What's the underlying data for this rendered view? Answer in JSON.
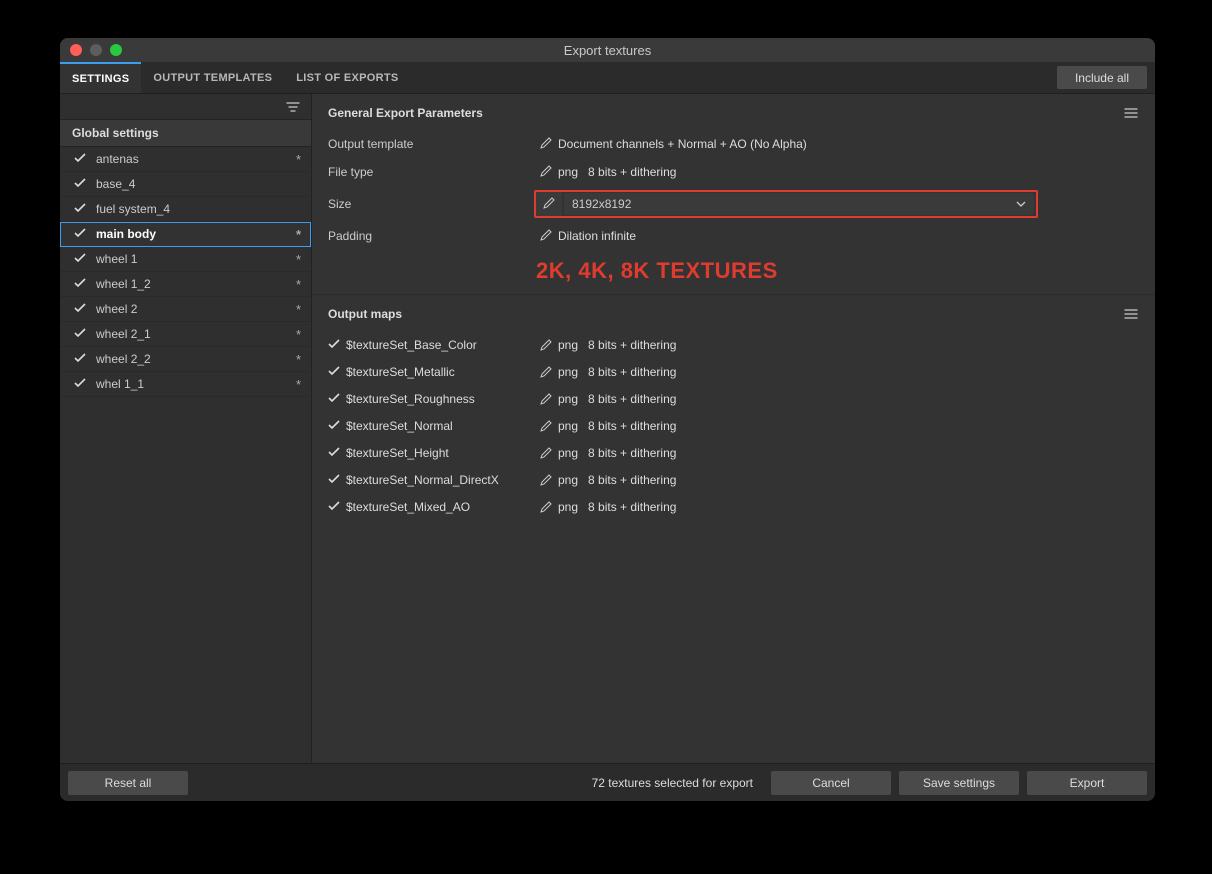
{
  "window": {
    "title": "Export textures"
  },
  "toolbar": {
    "tabs": [
      {
        "label": "SETTINGS",
        "active": true
      },
      {
        "label": "OUTPUT TEMPLATES",
        "active": false
      },
      {
        "label": "LIST OF EXPORTS",
        "active": false
      }
    ],
    "include_all": "Include all"
  },
  "sidebar": {
    "global_settings": "Global settings",
    "items": [
      {
        "name": "antenas",
        "modified": true,
        "selected": false
      },
      {
        "name": "base_4",
        "modified": false,
        "selected": false
      },
      {
        "name": "fuel system_4",
        "modified": false,
        "selected": false
      },
      {
        "name": "main body",
        "modified": true,
        "selected": true
      },
      {
        "name": "wheel 1",
        "modified": true,
        "selected": false
      },
      {
        "name": "wheel 1_2",
        "modified": true,
        "selected": false
      },
      {
        "name": "wheel 2",
        "modified": true,
        "selected": false
      },
      {
        "name": "wheel 2_1",
        "modified": true,
        "selected": false
      },
      {
        "name": "wheel 2_2",
        "modified": true,
        "selected": false
      },
      {
        "name": "whel 1_1",
        "modified": true,
        "selected": false
      }
    ]
  },
  "general": {
    "title": "General Export Parameters",
    "output_template": {
      "label": "Output template",
      "value": "Document channels + Normal + AO (No Alpha)"
    },
    "file_type": {
      "label": "File type",
      "format": "png",
      "spec": "8 bits + dithering"
    },
    "size": {
      "label": "Size",
      "value": "8192x8192"
    },
    "padding": {
      "label": "Padding",
      "value": "Dilation infinite"
    },
    "annotation": "2K, 4K, 8K TEXTURES"
  },
  "output_maps": {
    "title": "Output maps",
    "items": [
      {
        "name": "$textureSet_Base_Color",
        "format": "png",
        "spec": "8 bits + dithering"
      },
      {
        "name": "$textureSet_Metallic",
        "format": "png",
        "spec": "8 bits + dithering"
      },
      {
        "name": "$textureSet_Roughness",
        "format": "png",
        "spec": "8 bits + dithering"
      },
      {
        "name": "$textureSet_Normal",
        "format": "png",
        "spec": "8 bits + dithering"
      },
      {
        "name": "$textureSet_Height",
        "format": "png",
        "spec": "8 bits + dithering"
      },
      {
        "name": "$textureSet_Normal_DirectX",
        "format": "png",
        "spec": "8 bits + dithering"
      },
      {
        "name": "$textureSet_Mixed_AO",
        "format": "png",
        "spec": "8 bits + dithering"
      }
    ]
  },
  "footer": {
    "reset": "Reset all",
    "status": "72 textures selected for export",
    "cancel": "Cancel",
    "save": "Save settings",
    "export": "Export"
  }
}
